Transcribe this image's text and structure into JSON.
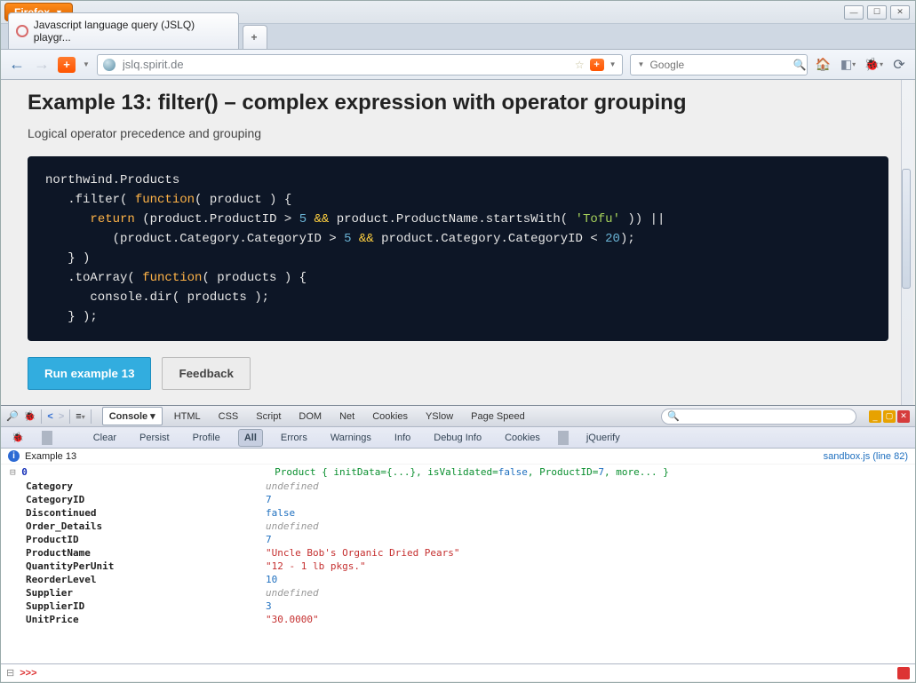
{
  "chrome": {
    "menu_label": "Firefox",
    "tab_title": "Javascript language query (JSLQ) playgr...",
    "url": "jslq.spirit.de",
    "search_placeholder": "Google"
  },
  "page": {
    "heading": "Example 13: filter() – complex expression with operator grouping",
    "subtitle": "Logical operator precedence and grouping",
    "run_label": "Run example 13",
    "feedback_label": "Feedback",
    "code": {
      "l1": "northwind.Products",
      "l2a": "   .filter( ",
      "l2b": "function",
      "l2c": "( product ) {",
      "l3a": "      ",
      "l3b": "return",
      "l3c": " (product.ProductID > ",
      "l3d": "5",
      "l3e": " ",
      "l3f": "&&",
      "l3g": " product.ProductName.startsWith( ",
      "l3h": "'Tofu'",
      "l3i": " )) ||",
      "l4a": "         (product.Category.CategoryID > ",
      "l4b": "5",
      "l4c": " ",
      "l4d": "&&",
      "l4e": " product.Category.CategoryID < ",
      "l4f": "20",
      "l4g": ");",
      "l5": "   } )",
      "l6a": "   .toArray( ",
      "l6b": "function",
      "l6c": "( products ) {",
      "l7": "      console.dir( products );",
      "l8": "   } );"
    }
  },
  "devtools": {
    "tabs": [
      "Console",
      "HTML",
      "CSS",
      "Script",
      "DOM",
      "Net",
      "Cookies",
      "YSlow",
      "Page Speed"
    ],
    "subtabs": [
      "Clear",
      "Persist",
      "Profile",
      "All",
      "Errors",
      "Warnings",
      "Info",
      "Debug Info",
      "Cookies",
      "jQuerify"
    ],
    "info_msg": "Example 13",
    "source_ref": "sandbox.js (line 82)",
    "obj_index": "0",
    "summary": "Product { initData={...}, isValidated=",
    "summary_false": "false",
    "summary_mid": ", ProductID=",
    "summary_pid": "7",
    "summary_end": ", more... }",
    "props": [
      {
        "k": "Category",
        "v": "undefined",
        "t": "und"
      },
      {
        "k": "CategoryID",
        "v": "7",
        "t": "num"
      },
      {
        "k": "Discontinued",
        "v": "false",
        "t": "bool"
      },
      {
        "k": "Order_Details",
        "v": "undefined",
        "t": "und"
      },
      {
        "k": "ProductID",
        "v": "7",
        "t": "num"
      },
      {
        "k": "ProductName",
        "v": "\"Uncle Bob's Organic Dried Pears\"",
        "t": "str"
      },
      {
        "k": "QuantityPerUnit",
        "v": "\"12 - 1 lb pkgs.\"",
        "t": "str"
      },
      {
        "k": "ReorderLevel",
        "v": "10",
        "t": "num"
      },
      {
        "k": "Supplier",
        "v": "undefined",
        "t": "und"
      },
      {
        "k": "SupplierID",
        "v": "3",
        "t": "num"
      },
      {
        "k": "UnitPrice",
        "v": "\"30.0000\"",
        "t": "str"
      }
    ],
    "prompt": ">>>"
  }
}
